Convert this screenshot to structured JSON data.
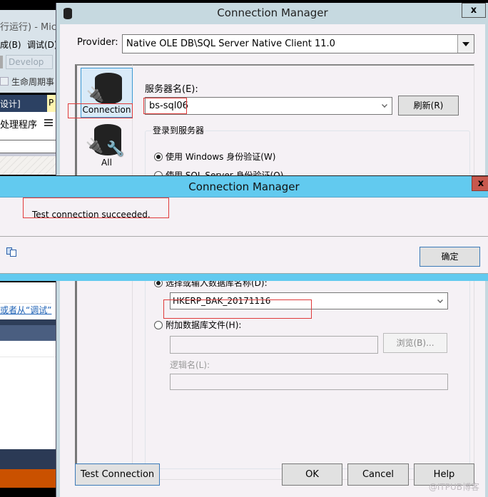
{
  "background_ide": {
    "title_fragment": "行运行) - Mic",
    "menu": [
      "成(B)",
      "调试(D)"
    ],
    "config_combo": "Develop",
    "toolbar_label": "生命周期事",
    "tab_label": "设计]",
    "yellow_tab": "P",
    "content_text": "处理程序",
    "link_text": "或者从“调试”"
  },
  "connection_manager": {
    "title": "Connection Manager",
    "provider_label": "Provider:",
    "provider_value": "Native OLE DB\\SQL Server Native Client 11.0",
    "sidebar": [
      {
        "label": "Connection",
        "selected": true
      },
      {
        "label": "All",
        "selected": false
      }
    ],
    "server_label": "服务器名(E):",
    "server_value": "bs-sql06",
    "refresh_label": "刷新(R)",
    "login_group_label": "登录到服务器",
    "auth_options": [
      {
        "label": "使用 Windows 身份验证(W)",
        "selected": true
      },
      {
        "label": "使用 SQL Server 身份验证(Q)",
        "selected": false
      }
    ],
    "db_options": [
      {
        "label": "选择或输入数据库名称(D):",
        "selected": true
      },
      {
        "label": "附加数据库文件(H):",
        "selected": false
      }
    ],
    "database_value": "HKERP_BAK_20171116",
    "attach_file_value": "",
    "browse_label": "浏览(B)...",
    "logical_name_label": "逻辑名(L):",
    "logical_name_value": "",
    "buttons": {
      "test_connection": "Test Connection",
      "ok": "OK",
      "cancel": "Cancel",
      "help": "Help"
    },
    "close_label": "x"
  },
  "message_box": {
    "title": "Connection Manager",
    "message": "Test connection succeeded.",
    "ok_label": "确定",
    "close_label": "x"
  },
  "watermark": "@ITPUB博客",
  "colors": {
    "msg_titlebar": "#62caef",
    "highlight_box": "#e03a3a",
    "selection": "#3b99d4"
  }
}
